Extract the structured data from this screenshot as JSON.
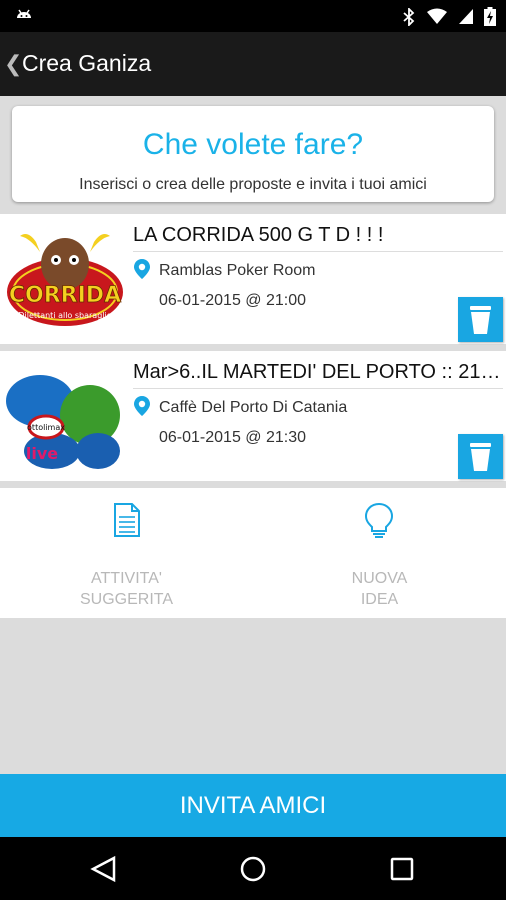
{
  "appbar": {
    "back_glyph": "❮",
    "title": "Crea Ganiza"
  },
  "header_card": {
    "heading": "Che volete fare?",
    "subtitle": "Inserisci o crea delle proposte e invita i tuoi amici"
  },
  "events": [
    {
      "title": "LA CORRIDA  500 G T D ! ! !",
      "place": "Ramblas Poker Room",
      "datetime": "06-01-2015 @ 21:00",
      "logo_text": "CORRIDA",
      "logo_sub": "Dilettanti allo sbaraglio"
    },
    {
      "title": "Mar>6..IL MARTEDI' DEL PORTO :: 21.…",
      "place": "Caffè Del Porto Di Catania",
      "datetime": "06-01-2015 @ 21:30",
      "logo_text": "live",
      "logo_sub": "ottolimax"
    }
  ],
  "actions": [
    {
      "label_line1": "ATTIVITA'",
      "label_line2": "SUGGERITA",
      "icon": "document-icon"
    },
    {
      "label_line1": "NUOVA",
      "label_line2": "IDEA",
      "icon": "lightbulb-icon"
    }
  ],
  "cta": {
    "label": "INVITA AMICI"
  },
  "colors": {
    "accent": "#17a9e4",
    "appbar": "#1a1a1a",
    "background": "#dcdcdc"
  }
}
